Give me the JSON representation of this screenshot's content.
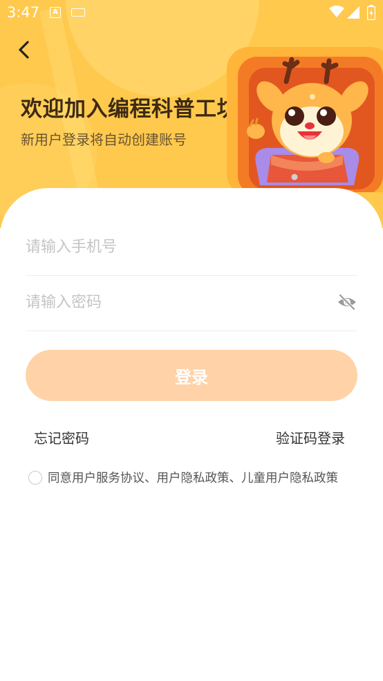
{
  "status_bar": {
    "time": "3:47"
  },
  "header": {
    "title": "欢迎加入编程科普工坊",
    "subtitle": "新用户登录将自动创建账号"
  },
  "form": {
    "phone_placeholder": "请输入手机号",
    "password_placeholder": "请输入密码",
    "login_label": "登录",
    "forgot_label": "忘记密码",
    "sms_login_label": "验证码登录",
    "agreement_text": "同意用户服务协议、用户隐私政策、儿童用户隐私政策"
  },
  "colors": {
    "header_bg": "#ffc94d",
    "button_bg": "#ffd2a8",
    "title": "#3d2a12"
  },
  "icons": [
    "back-arrow-icon",
    "eye-off-icon",
    "wifi-icon",
    "cellular-icon",
    "battery-icon",
    "keyboard-icon"
  ]
}
